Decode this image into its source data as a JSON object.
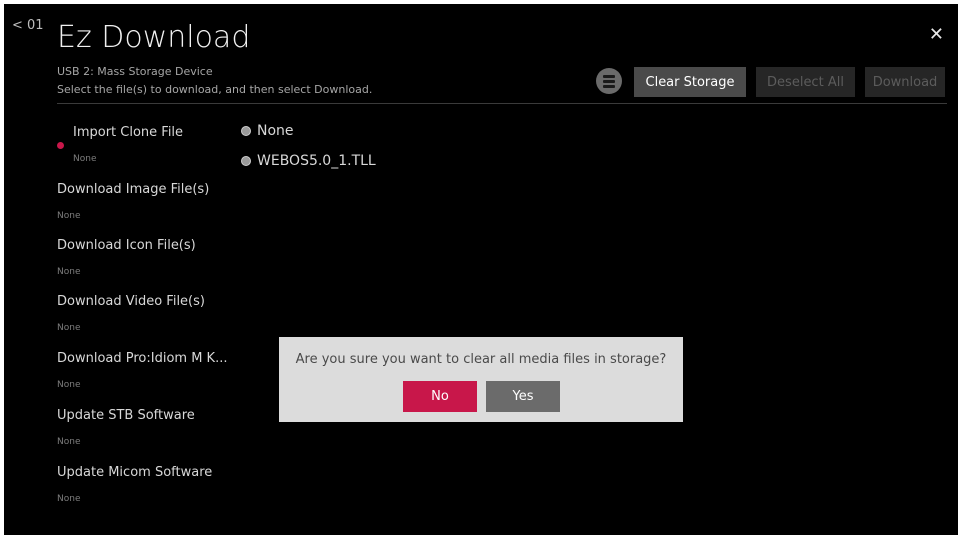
{
  "header": {
    "back_label": "< 01",
    "title": "Ez Download",
    "close_icon": "close-icon",
    "subtitle_device": "USB 2: Mass Storage Device",
    "subtitle_instruction": "Select the file(s) to download, and then select Download."
  },
  "toolbar": {
    "storage_icon": "storage-icon",
    "clear_storage_label": "Clear Storage",
    "deselect_all_label": "Deselect All",
    "download_label": "Download"
  },
  "menu": {
    "items": [
      {
        "label": "Import Clone File",
        "value": "None"
      },
      {
        "label": "Download Image File(s)",
        "value": "None"
      },
      {
        "label": "Download Icon File(s)",
        "value": "None"
      },
      {
        "label": "Download Video File(s)",
        "value": "None"
      },
      {
        "label": "Download Pro:Idiom M K...",
        "value": "None"
      },
      {
        "label": "Update STB Software",
        "value": "None"
      },
      {
        "label": "Update Micom Software",
        "value": "None"
      }
    ]
  },
  "options": {
    "items": [
      {
        "label": "None"
      },
      {
        "label": "WEBOS5.0_1.TLL"
      }
    ]
  },
  "dialog": {
    "message": "Are you sure you want to clear all media files in storage?",
    "no_label": "No",
    "yes_label": "Yes"
  },
  "colors": {
    "accent": "#c8174a",
    "background": "#000000",
    "dialog_bg": "#dcdcdc"
  }
}
